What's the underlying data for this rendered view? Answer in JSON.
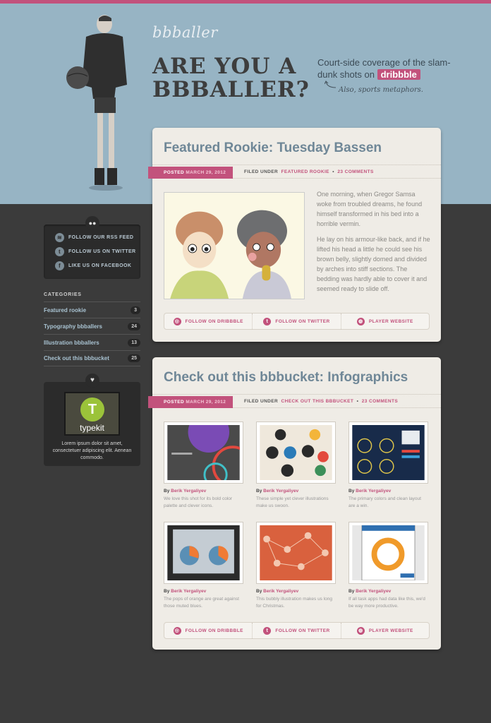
{
  "site": {
    "logo": "bbballer",
    "headline_1": "ARE YOU A",
    "headline_2": "BBBALLER?",
    "tagline": "Court-side coverage of the slam-dunk shots on",
    "tagline_badge": "dribbble",
    "aside": "Also, sports metaphors."
  },
  "sidebar": {
    "social": [
      {
        "label": "FOLLOW OUR RSS FEED",
        "icon": "rss-icon"
      },
      {
        "label": "FOLLOW US ON TWITTER",
        "icon": "twitter-icon"
      },
      {
        "label": "LIKE US ON FACEBOOK",
        "icon": "facebook-icon"
      }
    ],
    "categories_title": "CATEGORIES",
    "categories": [
      {
        "label": "Featured rookie",
        "count": "3"
      },
      {
        "label": "Typography bbballers",
        "count": "24"
      },
      {
        "label": "Illustration bbballers",
        "count": "13"
      },
      {
        "label": "Check out this bbbucket",
        "count": "25"
      }
    ],
    "ad": {
      "brand": "typekit",
      "text": "Lorem ipsum dolor sit amet, consectetuer adipiscing elit. Aenean commodo."
    }
  },
  "posts": [
    {
      "title": "Featured Rookie: Tuesday Bassen",
      "posted_label": "POSTED",
      "date": "MARCH 29, 2012",
      "filed_label": "FILED UNDER",
      "category": "FEATURED ROOKIE",
      "comments": "23 COMMENTS",
      "paragraphs": [
        "One morning, when Gregor Samsa woke from troubled dreams, he found himself transformed in his bed into a horrible vermin.",
        "He lay on his armour-like back, and if he lifted his head a little he could see his brown belly, slightly domed and divided by arches into stiff sections. The bedding was hardly able to cover it and seemed ready to slide off."
      ],
      "actions": [
        "FOLLOW ON DRIBBBLE",
        "FOLLOW ON TWITTER",
        "PLAYER WEBSITE"
      ]
    },
    {
      "title": "Check out this bbbucket: Infographics",
      "posted_label": "POSTED",
      "date": "MARCH 29, 2012",
      "filed_label": "FILED UNDER",
      "category": "CHECK OUT THIS BBBUCKET",
      "comments": "23 COMMENTS",
      "shots": [
        {
          "by": "By",
          "author": "Berik Yergaliyev",
          "desc": "We love this shot for its bold color palette and clever icons."
        },
        {
          "by": "By",
          "author": "Berik Yergaliyev",
          "desc": "These simple yet clever illustrations make us swoon."
        },
        {
          "by": "By",
          "author": "Berik Yergaliyev",
          "desc": "The primary colors and clean layout are a win."
        },
        {
          "by": "By",
          "author": "Berik Yergaliyev",
          "desc": "The pops of orange are great against those muted blues."
        },
        {
          "by": "By",
          "author": "Berik Yergaliyev",
          "desc": "This bubbly illustration makes us long for Christmas."
        },
        {
          "by": "By",
          "author": "Berik Yergaliyev",
          "desc": "If all task apps had data like this, we'd be way more productive."
        }
      ],
      "actions": [
        "FOLLOW ON DRIBBBLE",
        "FOLLOW ON TWITTER",
        "PLAYER WEBSITE"
      ]
    }
  ],
  "colors": {
    "accent": "#c2527c",
    "header_bg": "#97b4c4",
    "page_bg": "#3b3b3b",
    "card_bg": "#efece6"
  }
}
